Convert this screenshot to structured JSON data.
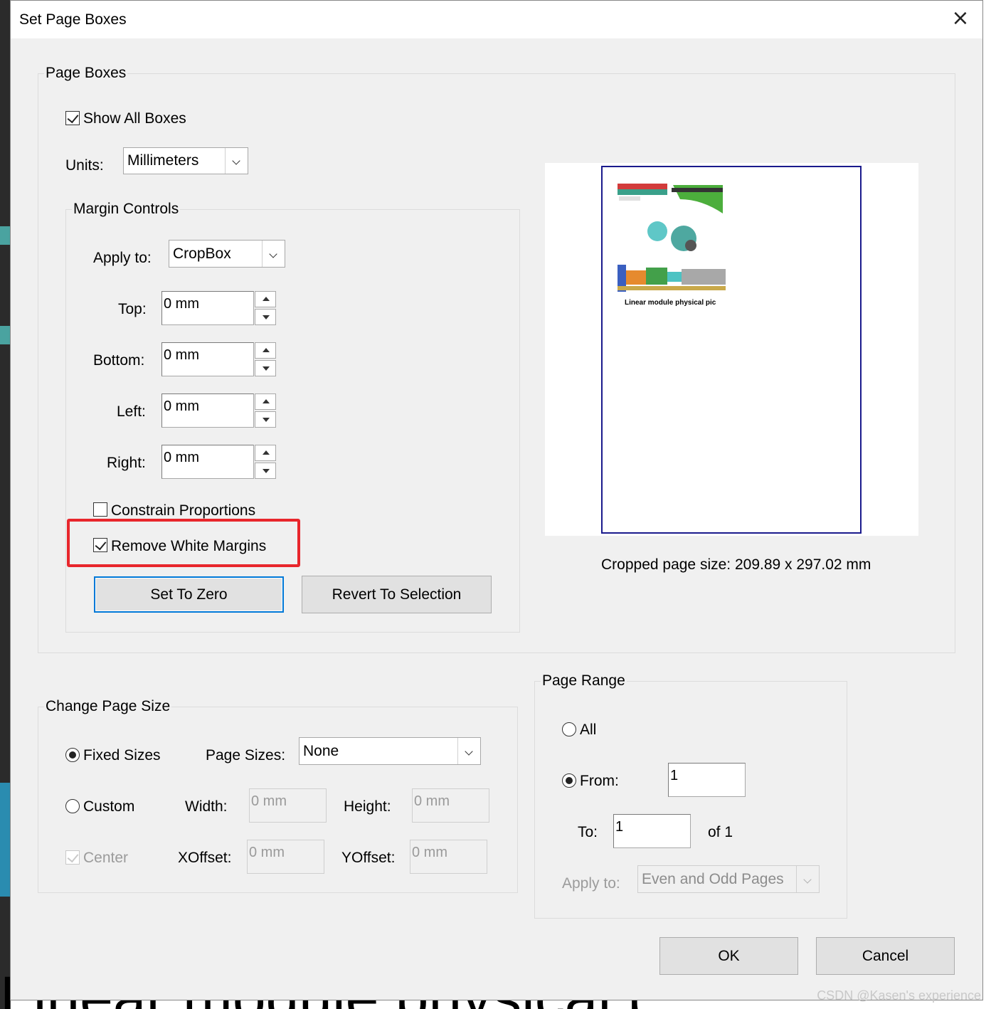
{
  "dialog": {
    "title": "Set Page Boxes",
    "close_glyph": "×"
  },
  "page_boxes": {
    "group_title": "Page Boxes",
    "show_all_boxes": {
      "label": "Show All Boxes",
      "checked": true
    },
    "units": {
      "label": "Units:",
      "value": "Millimeters"
    },
    "margin_controls": {
      "group_title": "Margin Controls",
      "apply_to": {
        "label": "Apply to:",
        "value": "CropBox"
      },
      "top": {
        "label": "Top:",
        "value": "0 mm"
      },
      "bottom": {
        "label": "Bottom:",
        "value": "0 mm"
      },
      "left": {
        "label": "Left:",
        "value": "0 mm"
      },
      "right": {
        "label": "Right:",
        "value": "0 mm"
      },
      "constrain_proportions": {
        "label": "Constrain Proportions",
        "checked": false
      },
      "remove_white_margins": {
        "label": "Remove White Margins",
        "checked": true
      },
      "set_to_zero": "Set To Zero",
      "revert_to_selection": "Revert To Selection"
    },
    "preview": {
      "caption": "Linear module physical pic",
      "cropped_size": "Cropped page size: 209.89 x 297.02 mm"
    }
  },
  "change_page_size": {
    "group_title": "Change Page Size",
    "fixed_sizes": {
      "label": "Fixed Sizes",
      "selected": true
    },
    "page_sizes": {
      "label": "Page Sizes:",
      "value": "None"
    },
    "custom": {
      "label": "Custom",
      "selected": false
    },
    "width": {
      "label": "Width:",
      "value": "0 mm"
    },
    "height": {
      "label": "Height:",
      "value": "0 mm"
    },
    "center": {
      "label": "Center",
      "checked": true
    },
    "xoffset": {
      "label": "XOffset:",
      "value": "0 mm"
    },
    "yoffset": {
      "label": "YOffset:",
      "value": "0 mm"
    }
  },
  "page_range": {
    "group_title": "Page Range",
    "all": {
      "label": "All",
      "selected": false
    },
    "from": {
      "label": "From:",
      "value": "1",
      "selected": true
    },
    "to": {
      "label": "To:",
      "value": "1"
    },
    "of_text": "of 1",
    "apply_to": {
      "label": "Apply to:",
      "value": "Even and Odd Pages"
    }
  },
  "buttons": {
    "ok": "OK",
    "cancel": "Cancel"
  },
  "background": {
    "bottom_text": "Linear module physical pic"
  },
  "watermark": "CSDN @Kasen's experience",
  "colors": {
    "highlight": "#e8262c",
    "accent": "#0078d7",
    "page_border": "#1a1a8c"
  }
}
